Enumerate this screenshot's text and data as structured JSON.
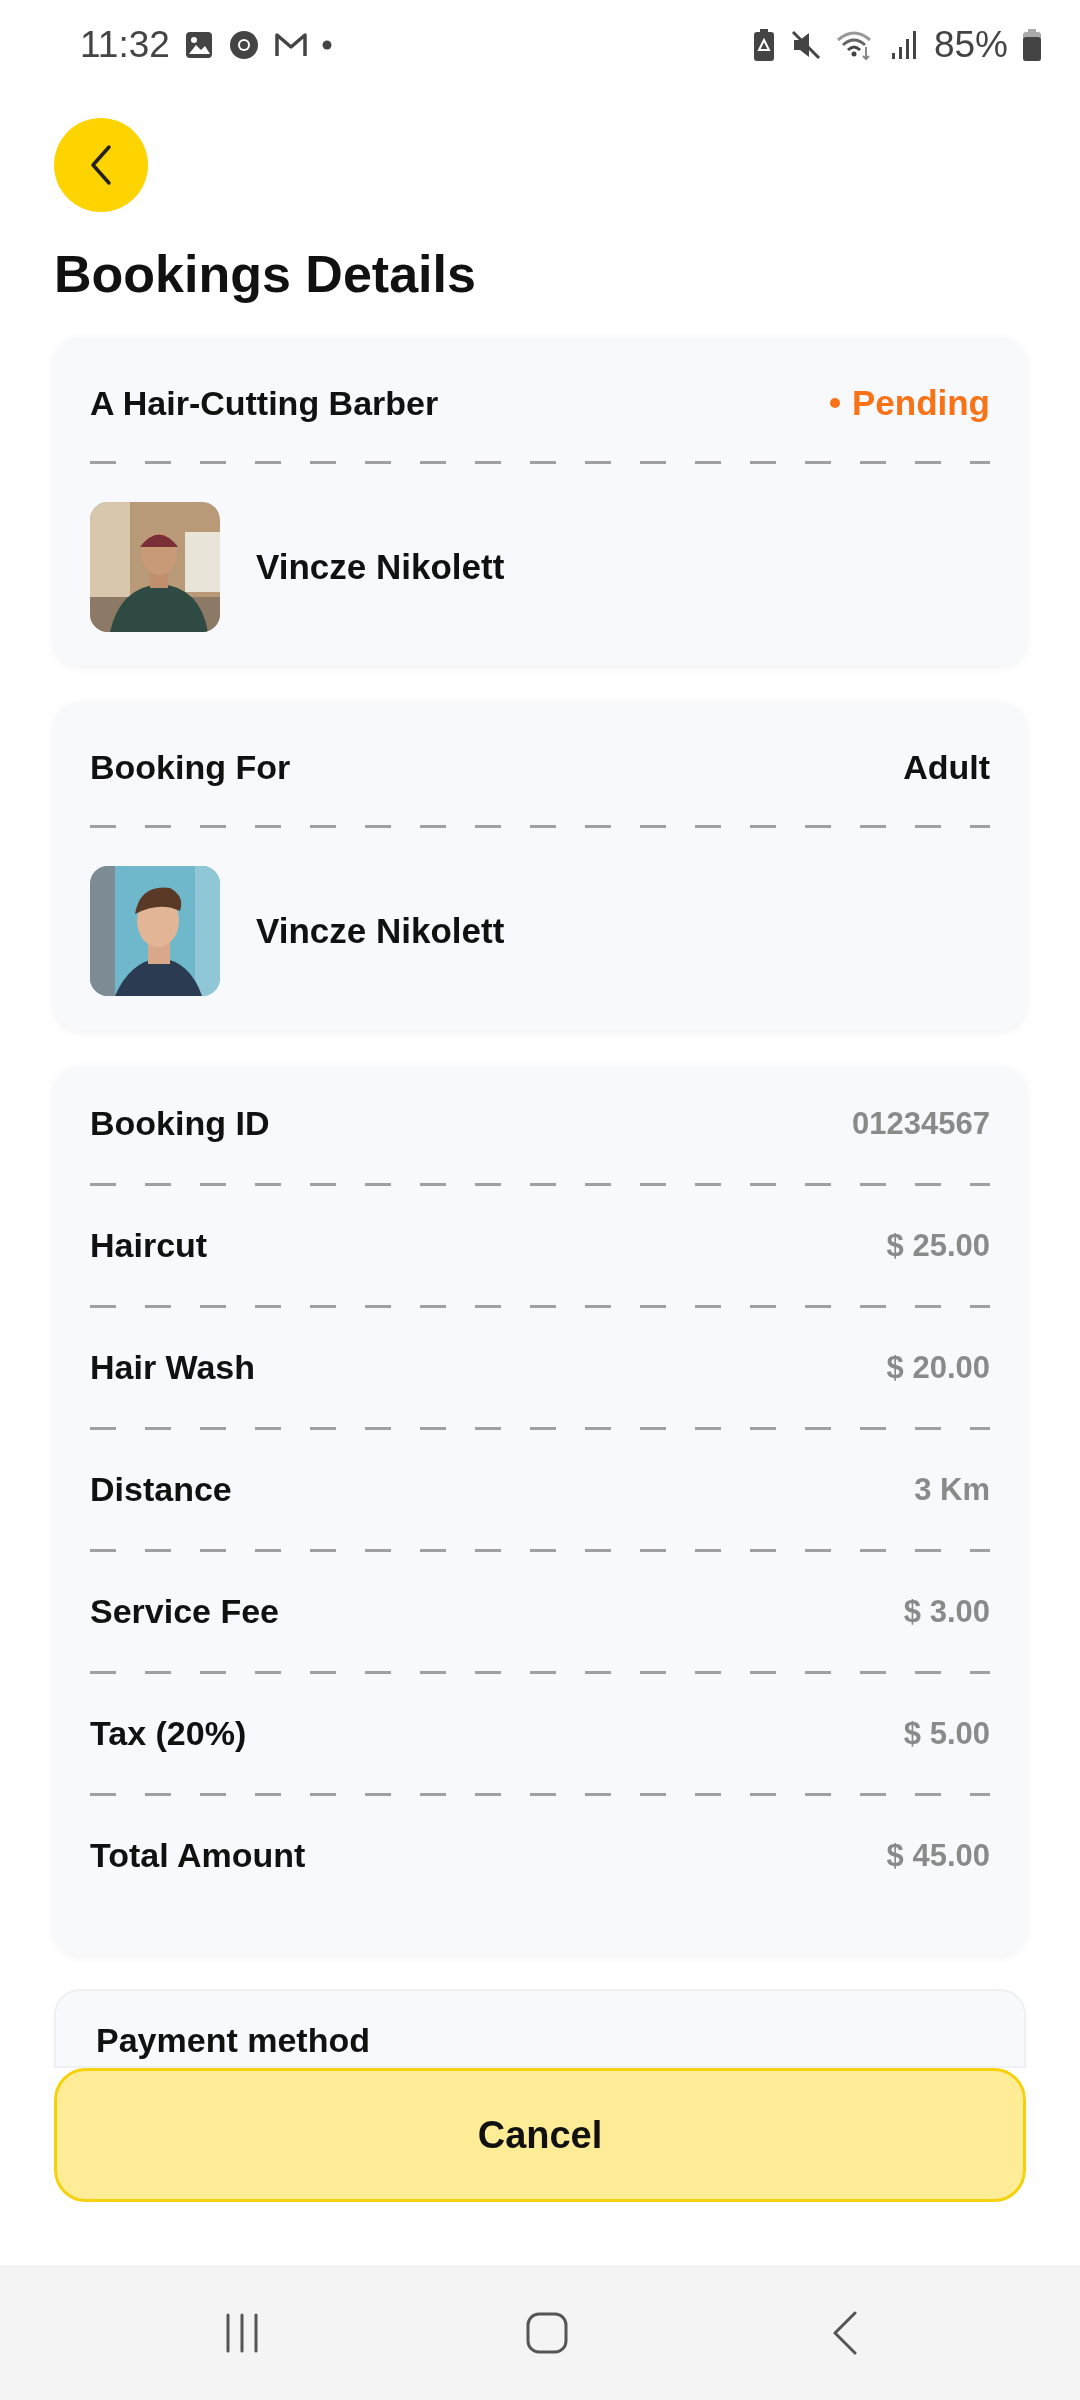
{
  "status_bar": {
    "time": "11:32",
    "battery": "85%"
  },
  "header": {
    "title": "Bookings Details"
  },
  "service_card": {
    "service": "A Hair-Cutting Barber",
    "status": "Pending",
    "name": "Vincze Nikolett"
  },
  "booking_for_card": {
    "label": "Booking For",
    "value": "Adult",
    "name": "Vincze Nikolett"
  },
  "summary": [
    {
      "label": "Booking ID",
      "value": "01234567"
    },
    {
      "label": "Haircut",
      "value": "$ 25.00"
    },
    {
      "label": "Hair Wash",
      "value": "$ 20.00"
    },
    {
      "label": "Distance",
      "value": "3 Km"
    },
    {
      "label": "Service Fee",
      "value": "$ 3.00"
    },
    {
      "label": "Tax (20%)",
      "value": "$ 5.00"
    },
    {
      "label": "Total Amount",
      "value": "$ 45.00"
    }
  ],
  "payment_card": {
    "title": "Payment method"
  },
  "cancel_button": "Cancel"
}
